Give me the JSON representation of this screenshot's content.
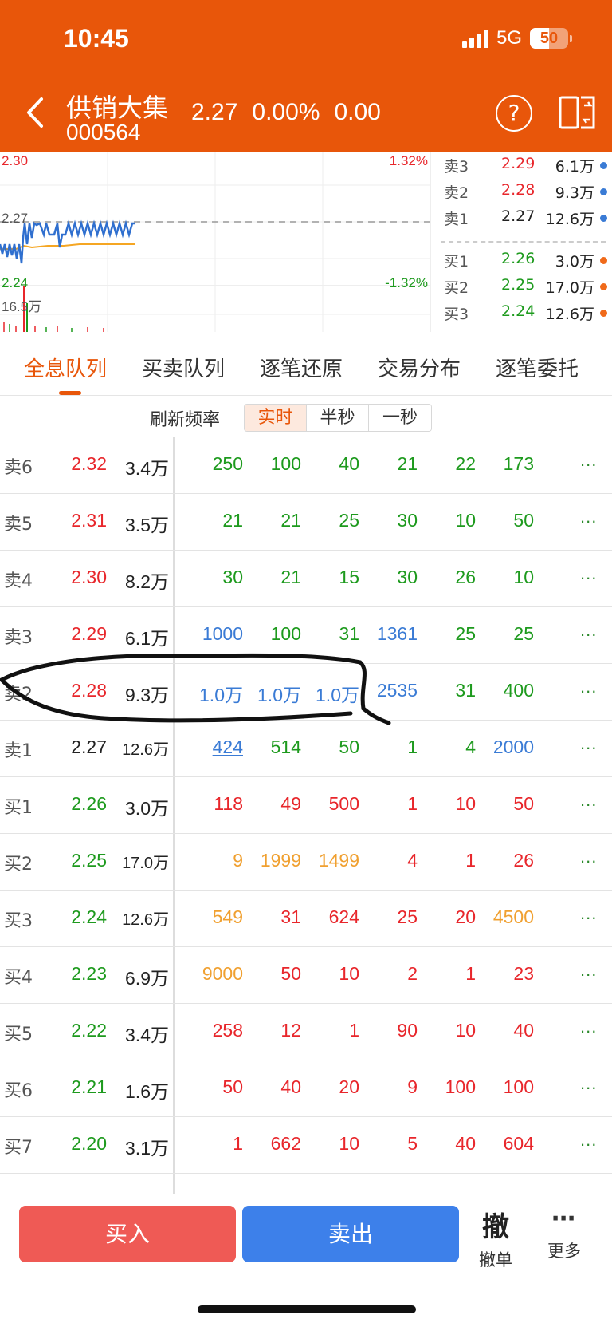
{
  "status_bar": {
    "time": "10:45",
    "network": "5G",
    "battery": "50",
    "battery_level_percent": 50
  },
  "stock": {
    "name": "供销大集",
    "code": "000564",
    "price": "2.27",
    "change_pct": "0.00%",
    "change": "0.00"
  },
  "chart": {
    "price_high": "2.30",
    "pct_high": "1.32%",
    "price_ref": "2.27",
    "price_low": "2.24",
    "pct_low": "-1.32%",
    "volume_max": "16.5万"
  },
  "order_book": {
    "asks": [
      {
        "label": "卖3",
        "price": "2.29",
        "volume": "6.1万"
      },
      {
        "label": "卖2",
        "price": "2.28",
        "volume": "9.3万"
      },
      {
        "label": "卖1",
        "price": "2.27",
        "volume": "12.6万"
      }
    ],
    "bids": [
      {
        "label": "买1",
        "price": "2.26",
        "volume": "3.0万"
      },
      {
        "label": "买2",
        "price": "2.25",
        "volume": "17.0万"
      },
      {
        "label": "买3",
        "price": "2.24",
        "volume": "12.6万"
      }
    ]
  },
  "tabs": [
    "全息队列",
    "买卖队列",
    "逐笔还原",
    "交易分布",
    "逐笔委托"
  ],
  "active_tab": "全息队列",
  "refresh": {
    "label": "刷新频率",
    "options": [
      "实时",
      "半秒",
      "一秒"
    ],
    "selected": "实时"
  },
  "queue_more": "...",
  "queue": [
    {
      "label": "卖6",
      "price": "2.32",
      "volume": "3.4万",
      "orders": [
        "250",
        "100",
        "40",
        "21",
        "22",
        "173"
      ]
    },
    {
      "label": "卖5",
      "price": "2.31",
      "volume": "3.5万",
      "orders": [
        "21",
        "21",
        "25",
        "30",
        "10",
        "50"
      ]
    },
    {
      "label": "卖4",
      "price": "2.30",
      "volume": "8.2万",
      "orders": [
        "30",
        "21",
        "15",
        "30",
        "26",
        "10"
      ]
    },
    {
      "label": "卖3",
      "price": "2.29",
      "volume": "6.1万",
      "orders": [
        "1000",
        "100",
        "31",
        "1361",
        "25",
        "25"
      ]
    },
    {
      "label": "卖2",
      "price": "2.28",
      "volume": "9.3万",
      "orders": [
        "1.0万",
        "1.0万",
        "1.0万",
        "2535",
        "31",
        "400"
      ]
    },
    {
      "label": "卖1",
      "price": "2.27",
      "volume": "12.6万",
      "orders": [
        "424",
        "514",
        "50",
        "1",
        "4",
        "2000"
      ]
    },
    {
      "label": "买1",
      "price": "2.26",
      "volume": "3.0万",
      "orders": [
        "118",
        "49",
        "500",
        "1",
        "10",
        "50"
      ]
    },
    {
      "label": "买2",
      "price": "2.25",
      "volume": "17.0万",
      "orders": [
        "9",
        "1999",
        "1499",
        "4",
        "1",
        "26"
      ]
    },
    {
      "label": "买3",
      "price": "2.24",
      "volume": "12.6万",
      "orders": [
        "549",
        "31",
        "624",
        "25",
        "20",
        "4500"
      ]
    },
    {
      "label": "买4",
      "price": "2.23",
      "volume": "6.9万",
      "orders": [
        "9000",
        "50",
        "10",
        "2",
        "1",
        "23"
      ]
    },
    {
      "label": "买5",
      "price": "2.22",
      "volume": "3.4万",
      "orders": [
        "258",
        "12",
        "1",
        "90",
        "10",
        "40"
      ]
    },
    {
      "label": "买6",
      "price": "2.21",
      "volume": "1.6万",
      "orders": [
        "50",
        "40",
        "20",
        "9",
        "100",
        "100"
      ]
    },
    {
      "label": "买7",
      "price": "2.20",
      "volume": "3.1万",
      "orders": [
        "1",
        "662",
        "10",
        "5",
        "40",
        "604"
      ]
    }
  ],
  "actions": {
    "buy": "买入",
    "sell": "卖出",
    "cancel_glyph": "撤",
    "cancel": "撤单",
    "more": "更多"
  },
  "colors": {
    "header": "#e8560a",
    "up": "#e8262b",
    "down": "#1d9a1d",
    "large_order": "#3a7bd5",
    "mid_order": "#f0a030"
  }
}
